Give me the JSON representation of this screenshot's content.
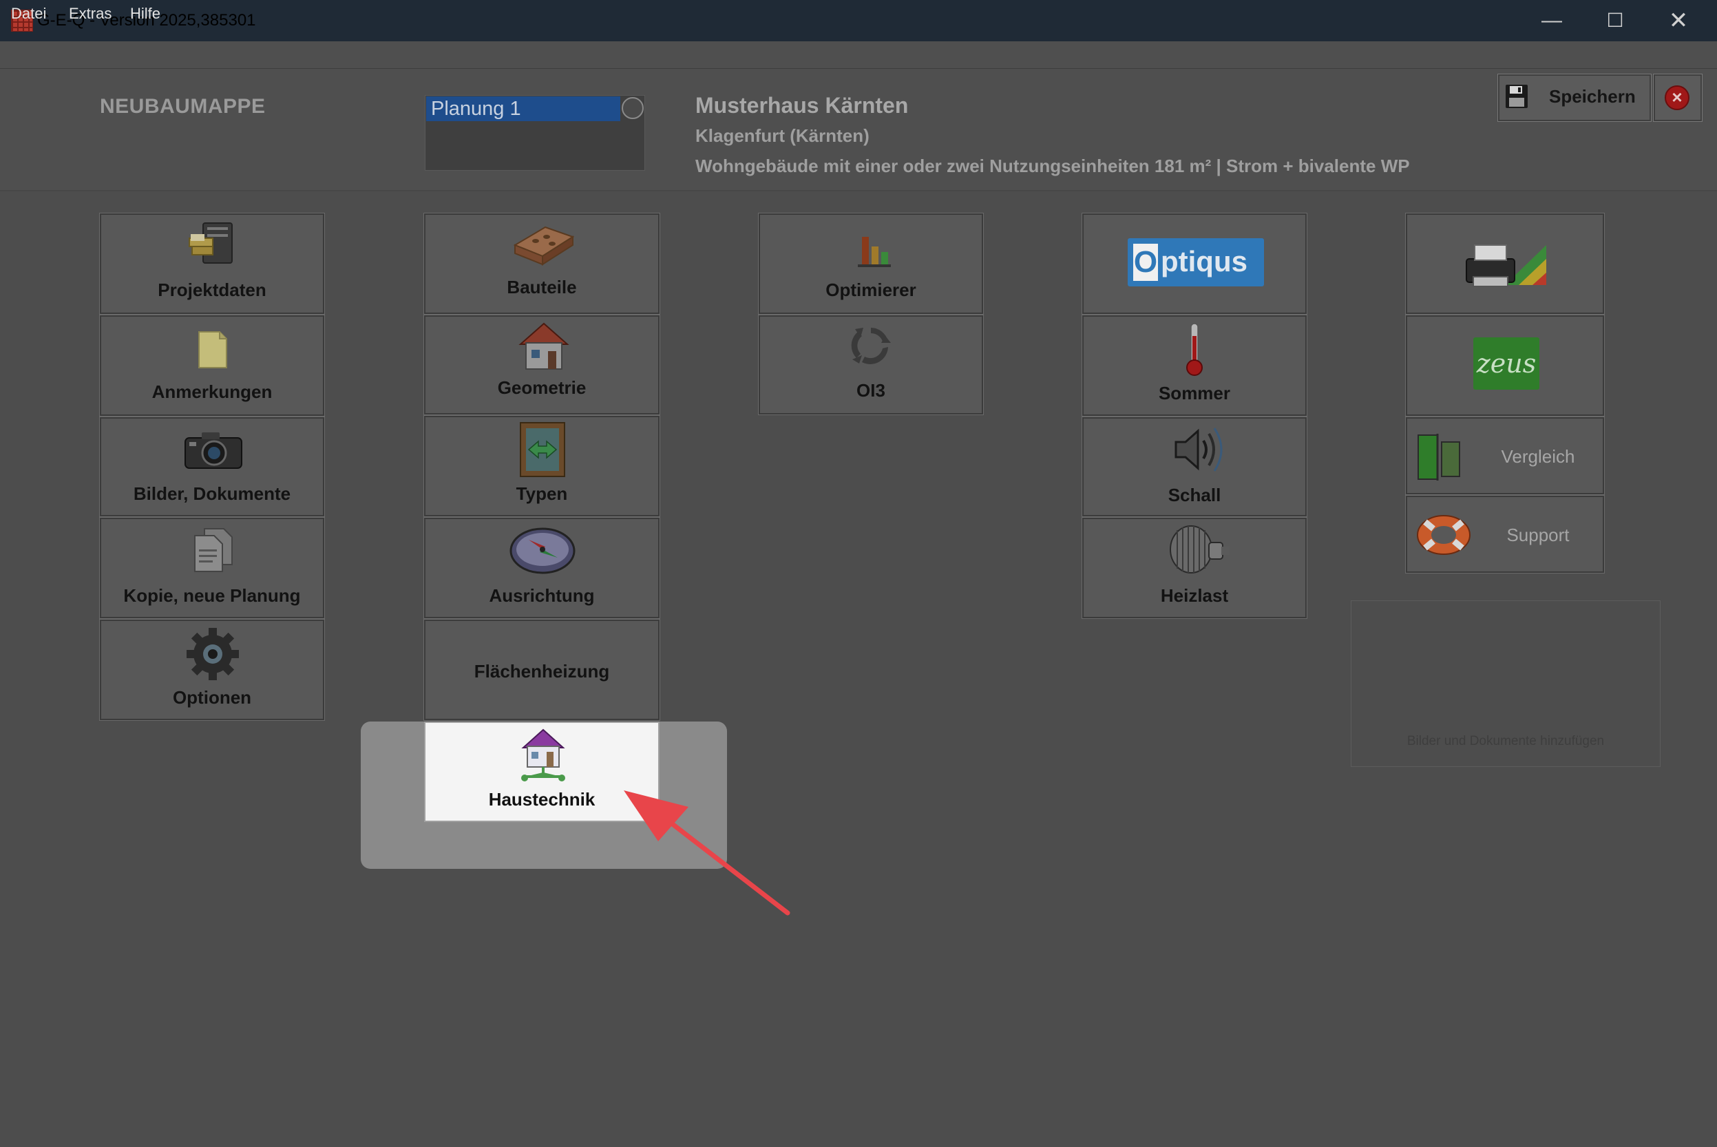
{
  "window": {
    "title": "G-E-Q - Version 2025,385301",
    "minimize": "—",
    "maximize": "☐",
    "close": "✕"
  },
  "menu": {
    "datei": "Datei",
    "extras": "Extras",
    "hilfe": "Hilfe"
  },
  "header": {
    "folder_title": "NEUBAUMAPPE",
    "planung_selected": "Planung 1",
    "project_name": "Musterhaus Kärnten",
    "project_location": "Klagenfurt (Kärnten)",
    "project_desc": "Wohngebäude mit einer oder zwei Nutzungseinheiten  181 m²  |  Strom + bivalente WP",
    "save_label": "Speichern",
    "cancel_icon": "×"
  },
  "tiles": {
    "projektdaten": "Projektdaten",
    "anmerkungen": "Anmerkungen",
    "bilder": "Bilder, Dokumente",
    "kopie": "Kopie, neue Planung",
    "optionen": "Optionen",
    "bauteile": "Bauteile",
    "geometrie": "Geometrie",
    "typen": "Typen",
    "ausrichtung": "Ausrichtung",
    "flaechenheizung": "Flächenheizung",
    "haustechnik": "Haustechnik",
    "optimierer": "Optimierer",
    "oi3": "OI3",
    "optiqus_o": "O",
    "optiqus_rest": "ptiqus",
    "sommer": "Sommer",
    "schall": "Schall",
    "heizlast": "Heizlast",
    "zeus": "zeus",
    "vergleich": "Vergleich",
    "support": "Support"
  },
  "media": {
    "drop_hint": "Bilder und Dokumente hinzufügen"
  },
  "colors": {
    "accent_selection": "#1e4d8c",
    "annotation_arrow": "#e8454a",
    "zeus_green": "#2f7d2a",
    "optiqus_blue": "#2f78b8"
  }
}
